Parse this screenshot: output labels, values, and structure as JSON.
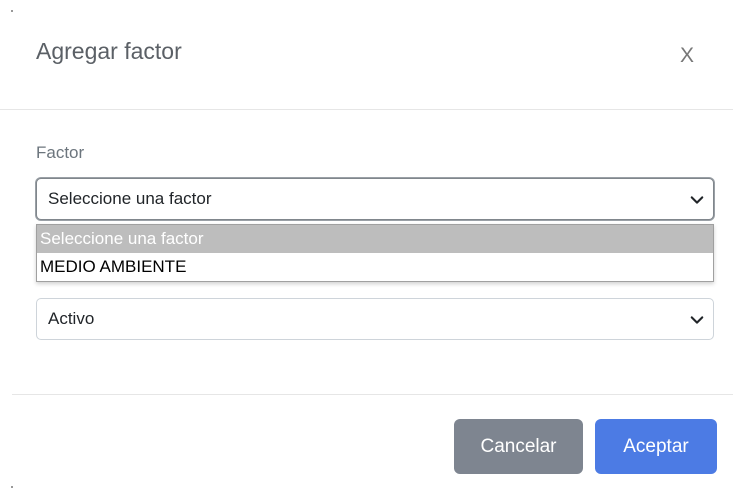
{
  "modal": {
    "title": "Agregar factor",
    "close_label": "X"
  },
  "form": {
    "factor_label": "Factor",
    "factor_select": {
      "value": "Seleccione una factor",
      "options": [
        "Seleccione una factor",
        "MEDIO AMBIENTE"
      ],
      "open": true,
      "highlighted_index": 0
    },
    "status_select": {
      "value": "Activo"
    }
  },
  "footer": {
    "cancel_label": "Cancelar",
    "accept_label": "Aceptar"
  },
  "colors": {
    "cancel_button": "#7e8590",
    "accept_button": "#4c7be4",
    "highlighted_option": "#bdbdbd"
  }
}
